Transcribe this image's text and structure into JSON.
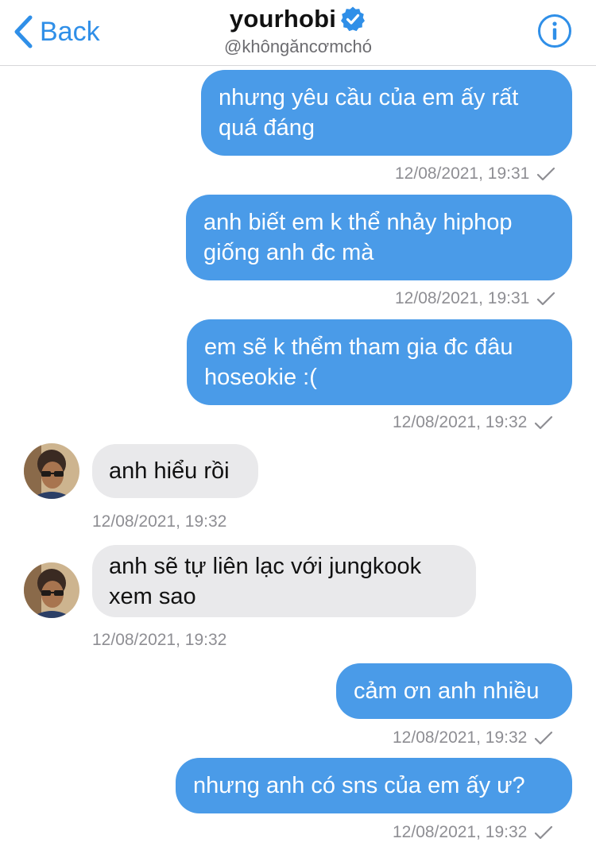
{
  "header": {
    "back_label": "Back",
    "title": "yourhobi",
    "handle": "@khôngăncơmchó",
    "verified": true,
    "accent_color": "#2f8fe8"
  },
  "messages": [
    {
      "direction": "outgoing",
      "lines": [
        "nhưng yêu cầu của em ấy rất",
        "quá đáng"
      ],
      "timestamp": "12/08/2021, 19:31",
      "read": true
    },
    {
      "direction": "outgoing",
      "lines": [
        "anh biết em k thể nhảy hiphop",
        "giống anh đc mà"
      ],
      "timestamp": "12/08/2021, 19:31",
      "read": true
    },
    {
      "direction": "outgoing",
      "lines": [
        "em sẽ k thểm tham gia đc đâu",
        "hoseokie :("
      ],
      "timestamp": "12/08/2021, 19:32",
      "read": true
    },
    {
      "direction": "incoming",
      "lines": [
        "anh hiểu rồi"
      ],
      "timestamp": "12/08/2021, 19:32"
    },
    {
      "direction": "incoming",
      "lines": [
        "anh sẽ tự liên lạc với jungkook",
        "xem sao"
      ],
      "timestamp": "12/08/2021, 19:32"
    },
    {
      "direction": "outgoing",
      "lines": [
        "cảm ơn anh nhiều"
      ],
      "timestamp": "12/08/2021, 19:32",
      "read": true
    },
    {
      "direction": "outgoing",
      "lines": [
        "nhưng anh có sns của em ấy ư?"
      ],
      "timestamp": "12/08/2021, 19:32",
      "read": true
    }
  ],
  "colors": {
    "outgoing_bubble": "#4a9be8",
    "incoming_bubble": "#e9e9eb",
    "timestamp_text": "#8e8e93"
  }
}
